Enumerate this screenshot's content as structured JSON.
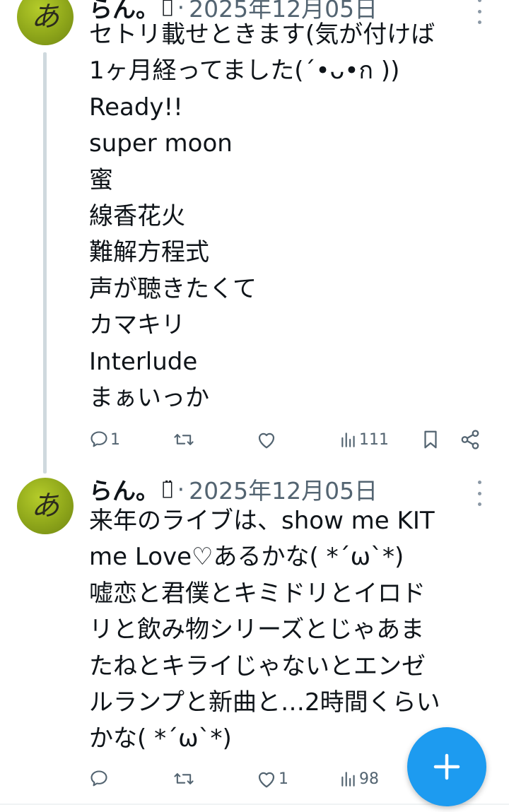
{
  "tweets": [
    {
      "author": "らん。",
      "author_deco": "ꈊ̈",
      "separator": "·",
      "date": "2025年12月05日",
      "avatar_glyph": "あ",
      "lines": [
        "セトリ載せときます(気が付けば",
        "1ヶ月経ってました(´•ᴗ•ก ))",
        "Ready!!",
        "super moon",
        "蜜",
        "線香花火",
        "難解方程式",
        "声が聴きたくて",
        "カマキリ",
        "Interlude",
        "まぁいっか"
      ],
      "replies": "1",
      "retweets": "",
      "likes": "",
      "views": "111"
    },
    {
      "author": "らん。",
      "author_deco": "ꈊ̈",
      "separator": "·",
      "date": "2025年12月05日",
      "avatar_glyph": "あ",
      "lines": [
        "来年のライブは、show me KIT",
        "me Love♡あるかな( *´ω`*)",
        "嘘恋と君僕とキミドリとイロド",
        "リと飲み物シリーズとじゃあま",
        "たねとキライじゃないとエンゼ",
        "ルランプと新曲と…2時間くらい",
        "かな( *´ω`*)"
      ],
      "replies": "",
      "retweets": "",
      "likes": "1",
      "views": "98"
    }
  ],
  "fab": {
    "label": "+",
    "color": "#1d9bf0"
  },
  "colors": {
    "text": "#0f1419",
    "secondary": "#536471",
    "accent": "#1d9bf0",
    "thread_line": "#cfd9de"
  },
  "icons": {
    "reply": "reply-icon",
    "retweet": "retweet-icon",
    "like": "heart-icon",
    "views": "views-icon",
    "bookmark": "bookmark-icon",
    "share": "share-icon",
    "more": "more-vertical-icon",
    "compose": "plus-icon"
  }
}
